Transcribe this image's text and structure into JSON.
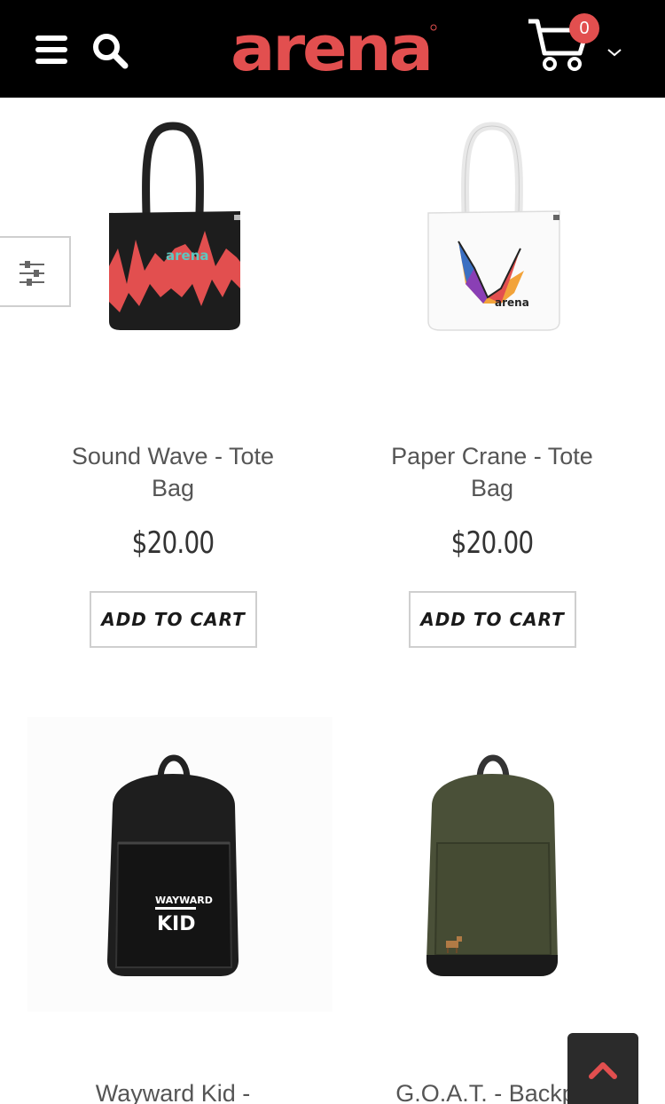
{
  "header": {
    "logo_text": "arena",
    "cart_count": "0",
    "icons": {
      "menu": "hamburger-menu-icon",
      "search": "search-icon",
      "cart": "cart-icon",
      "dropdown": "chevron-down-icon"
    },
    "colors": {
      "background": "#000000",
      "brand": "#e24f4f",
      "badge": "#e24f4f"
    }
  },
  "filters": {
    "icon": "sliders-icon"
  },
  "products": [
    {
      "name_line1": "Sound Wave - Tote",
      "name_line2": "Bag",
      "price": "$20.00",
      "button": "ADD TO CART",
      "image_text": "arena"
    },
    {
      "name_line1": "Paper Crane - Tote",
      "name_line2": "Bag",
      "price": "$20.00",
      "button": "ADD TO CART",
      "image_text": "arena"
    },
    {
      "name_line1": "Wayward Kid -",
      "image_text_top": "WAYWARD",
      "image_text_bottom": "KID"
    },
    {
      "name_line1": "G.O.A.T. - Backpa"
    }
  ],
  "back_to_top": {
    "icon": "chevron-up-icon",
    "color": "#e24f4f"
  }
}
